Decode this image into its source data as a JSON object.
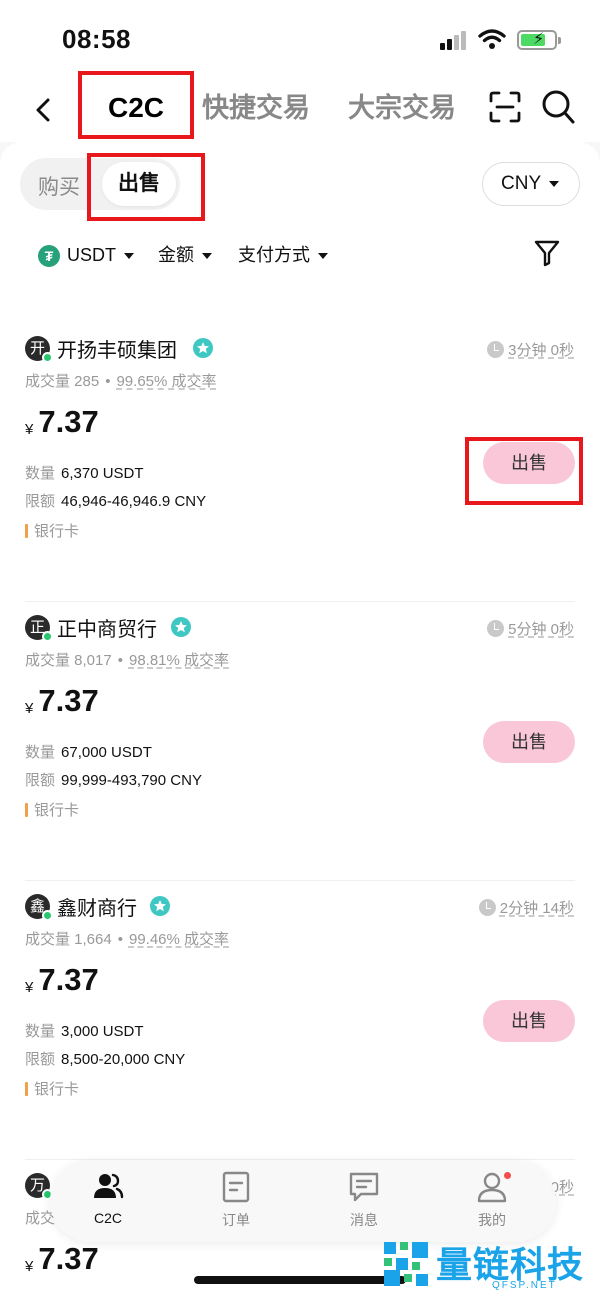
{
  "status_bar": {
    "time": "08:58"
  },
  "top_nav": {
    "tabs": [
      {
        "label": "C2C",
        "active": true
      },
      {
        "label": "快捷交易",
        "active": false
      },
      {
        "label": "大宗交易",
        "active": false
      }
    ]
  },
  "trade_side": {
    "buy_label": "购买",
    "sell_label": "出售",
    "selected": "出售"
  },
  "currency": {
    "selected": "CNY"
  },
  "filters": {
    "asset": "USDT",
    "amount": "金额",
    "payment": "支付方式"
  },
  "listings": [
    {
      "avatar_char": "开",
      "name": "开扬丰硕集团",
      "time": "3分钟 0秒",
      "trades_label": "成交量 285",
      "rate_label": "99.65% 成交率",
      "currency_symbol": "¥",
      "price": "7.37",
      "qty_label": "数量",
      "qty": "6,370 USDT",
      "limit_label": "限额",
      "limit": "46,946-46,946.9 CNY",
      "payment": "银行卡",
      "action": "出售"
    },
    {
      "avatar_char": "正",
      "name": "正中商贸行",
      "time": "5分钟 0秒",
      "trades_label": "成交量 8,017",
      "rate_label": "98.81% 成交率",
      "currency_symbol": "¥",
      "price": "7.37",
      "qty_label": "数量",
      "qty": "67,000 USDT",
      "limit_label": "限额",
      "limit": "99,999-493,790 CNY",
      "payment": "银行卡",
      "action": "出售"
    },
    {
      "avatar_char": "鑫",
      "name": "鑫财商行",
      "time": "2分钟 14秒",
      "trades_label": "成交量 1,664",
      "rate_label": "99.46% 成交率",
      "currency_symbol": "¥",
      "price": "7.37",
      "qty_label": "数量",
      "qty": "3,000 USDT",
      "limit_label": "限额",
      "limit": "8,500-20,000 CNY",
      "payment": "银行卡",
      "action": "出售"
    },
    {
      "avatar_char": "万",
      "time_partial": "0秒",
      "trades_partial": "成交",
      "currency_symbol": "¥",
      "price": "7.37"
    }
  ],
  "tabbar": {
    "items": [
      {
        "label": "C2C",
        "icon": "users-icon",
        "active": true
      },
      {
        "label": "订单",
        "icon": "order-icon",
        "active": false
      },
      {
        "label": "消息",
        "icon": "message-icon",
        "active": false
      },
      {
        "label": "我的",
        "icon": "profile-icon",
        "active": false,
        "badge": true
      }
    ]
  },
  "watermark": {
    "text": "量链科技",
    "sub": "QFSP.NET"
  },
  "colors": {
    "sell_button": "#f9c7d8",
    "annotation": "#e8171b",
    "tether": "#26a17b",
    "online": "#28c76f"
  }
}
